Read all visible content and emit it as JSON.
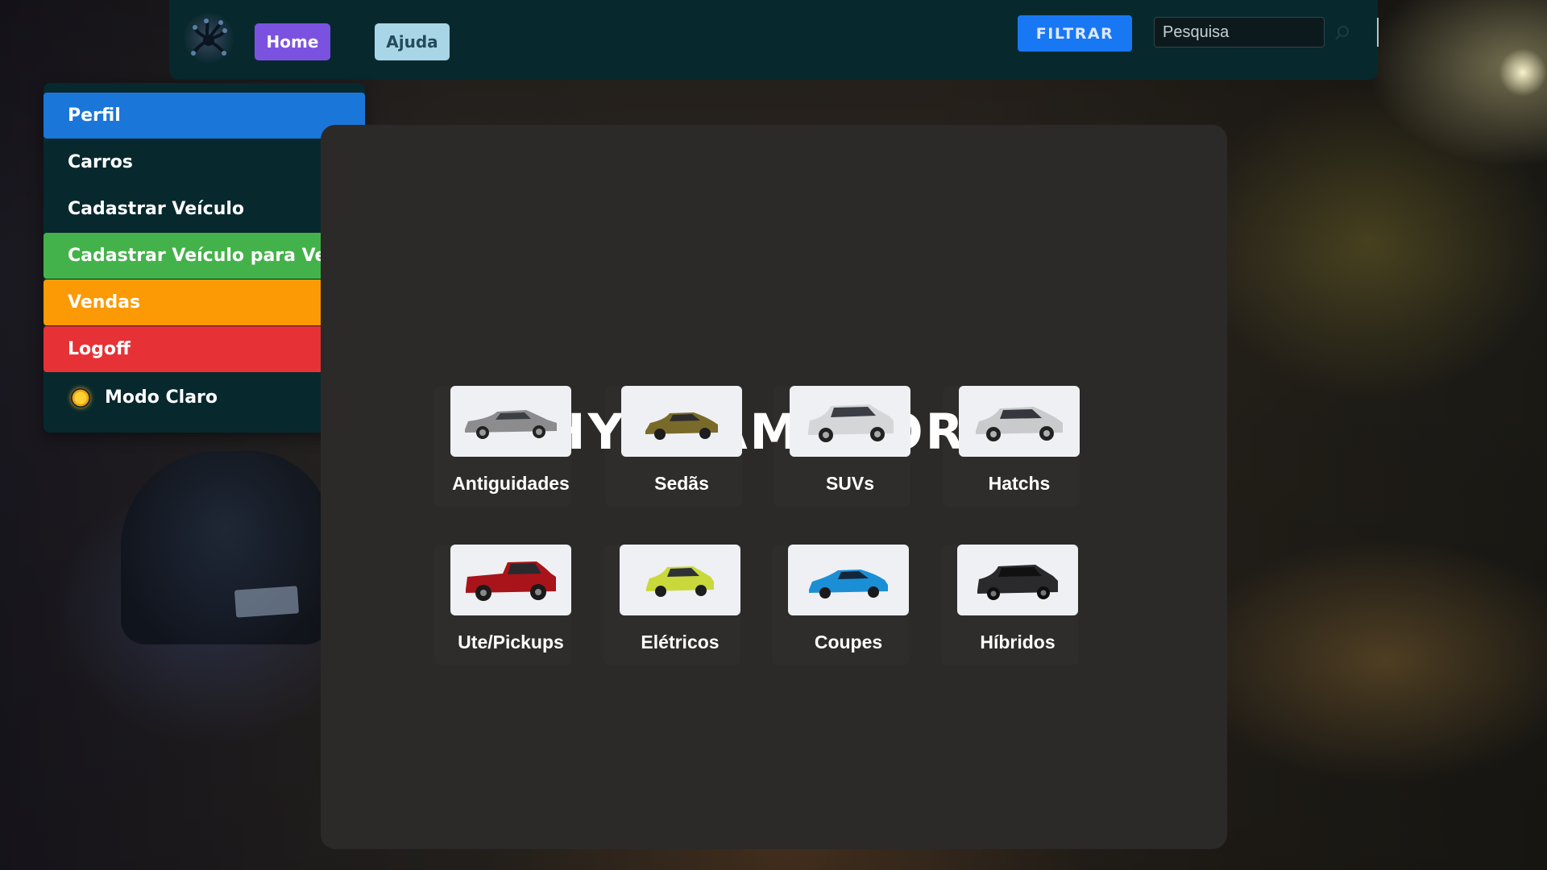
{
  "nav": {
    "home_label": "Home",
    "ajuda_label": "Ajuda",
    "filter_label": "FILTRAR",
    "search_placeholder": "Pesquisa"
  },
  "sidebar": {
    "items": [
      {
        "label": "Perfil",
        "color": "#1b76d9"
      },
      {
        "label": "Carros"
      },
      {
        "label": "Cadastrar Veículo"
      },
      {
        "label": "Cadastrar Veículo para Venda",
        "color": "#44b24a"
      },
      {
        "label": "Vendas",
        "color": "#fb9a04"
      },
      {
        "label": "Logoff",
        "color": "#e63236"
      }
    ],
    "mode_label": "Modo Claro",
    "mode_icon": "sun-icon"
  },
  "main": {
    "brand": "HYDRAMOTORS",
    "categories": [
      {
        "label": "Antiguidades",
        "car_color": "#8c8c8e"
      },
      {
        "label": "Sedãs",
        "car_color": "#7a6a2a"
      },
      {
        "label": "SUVs",
        "car_color": "#d4d6d8"
      },
      {
        "label": "Hatchs",
        "car_color": "#c8cacc"
      },
      {
        "label": "Ute/Pickups",
        "car_color": "#a8141a"
      },
      {
        "label": "Elétricos",
        "car_color": "#c9d83a"
      },
      {
        "label": "Coupes",
        "car_color": "#1a8fd6"
      },
      {
        "label": "Híbridos",
        "car_color": "#2a2a2c"
      }
    ]
  },
  "colors": {
    "navbar": "#07292e",
    "panel": "#2b2a28",
    "home_button": "#7b52e0",
    "filter_button": "#1878f3"
  }
}
